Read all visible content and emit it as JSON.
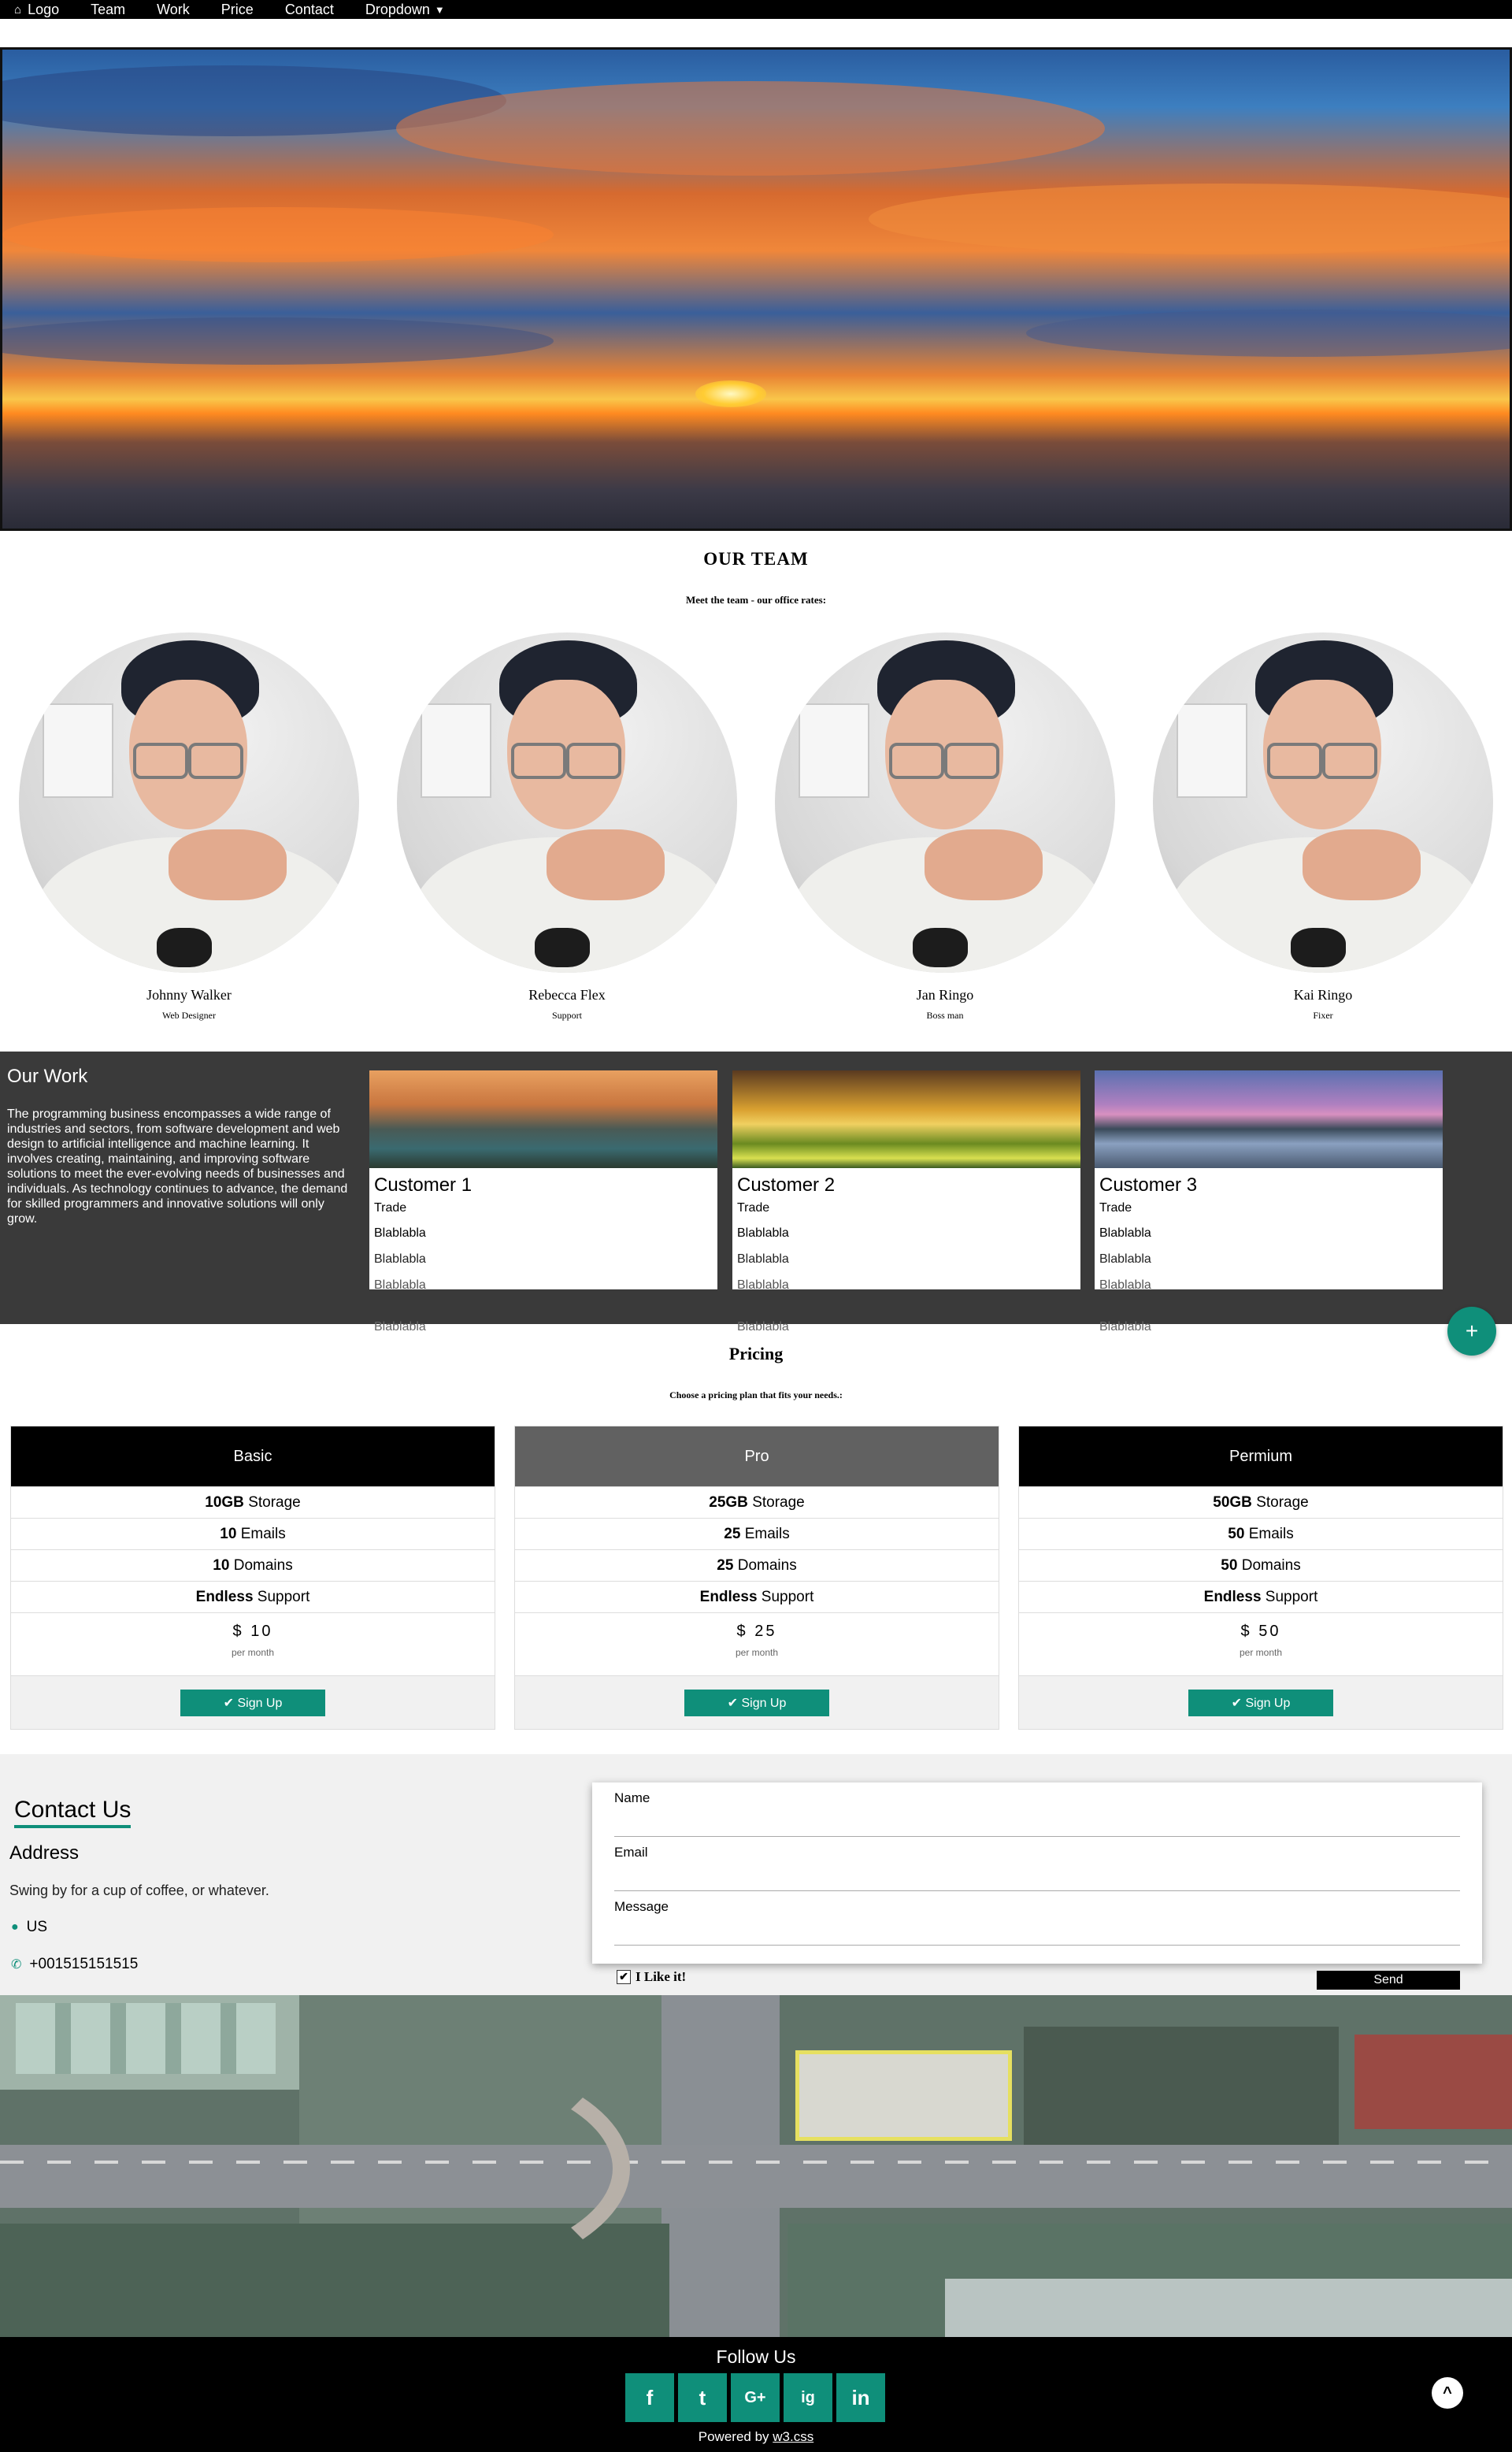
{
  "nav": {
    "logo": "Logo",
    "items": [
      "Team",
      "Work",
      "Price",
      "Contact"
    ],
    "dropdown": "Dropdown"
  },
  "team": {
    "title": "OUR TEAM",
    "subtitle": "Meet the team - our office rates:",
    "members": [
      {
        "name": "Johnny Walker",
        "role": "Web Designer"
      },
      {
        "name": "Rebecca Flex",
        "role": "Support"
      },
      {
        "name": "Jan Ringo",
        "role": "Boss man"
      },
      {
        "name": "Kai Ringo",
        "role": "Fixer"
      }
    ]
  },
  "work": {
    "title": "Our Work",
    "text": "The programming business encompasses a wide range of industries and sectors, from software development and web design to artificial intelligence and machine learning. It involves creating, maintaining, and improving software solutions to meet the ever-evolving needs of businesses and individuals. As technology continues to advance, the demand for skilled programmers and innovative solutions will only grow.",
    "cards": [
      {
        "title": "Customer 1",
        "tag": "Trade",
        "lines": [
          "Blablabla",
          "Blablabla",
          "Blablabla",
          "Blablabla"
        ]
      },
      {
        "title": "Customer 2",
        "tag": "Trade",
        "lines": [
          "Blablabla",
          "Blablabla",
          "Blablabla",
          "Blablabla"
        ]
      },
      {
        "title": "Customer 3",
        "tag": "Trade",
        "lines": [
          "Blablabla",
          "Blablabla",
          "Blablabla",
          "Blablabla"
        ]
      }
    ],
    "fab": "+"
  },
  "pricing": {
    "title": "Pricing",
    "subtitle": "Choose a pricing plan that fits your needs.:",
    "plans": [
      {
        "name": "Basic",
        "storage_b": "10GB",
        "storage": "Storage",
        "emails_b": "10",
        "emails": "Emails",
        "domains_b": "10",
        "domains": "Domains",
        "support_b": "Endless",
        "support": "Support",
        "amount": "$ 10",
        "per": "per month",
        "button": "✔ Sign Up",
        "header_color": "#000000"
      },
      {
        "name": "Pro",
        "storage_b": "25GB",
        "storage": "Storage",
        "emails_b": "25",
        "emails": "Emails",
        "domains_b": "25",
        "domains": "Domains",
        "support_b": "Endless",
        "support": "Support",
        "amount": "$ 25",
        "per": "per month",
        "button": "✔ Sign Up",
        "header_color": "#616161"
      },
      {
        "name": "Permium",
        "storage_b": "50GB",
        "storage": "Storage",
        "emails_b": "50",
        "emails": "Emails",
        "domains_b": "50",
        "domains": "Domains",
        "support_b": "Endless",
        "support": "Support",
        "amount": "$ 50",
        "per": "per month",
        "button": "✔ Sign Up",
        "header_color": "#000000"
      }
    ]
  },
  "contact": {
    "title": "Contact Us",
    "address_heading": "Address",
    "tagline": "Swing by for a cup of coffee, or whatever.",
    "location": "US",
    "phone": "+001515151515",
    "fields": {
      "name": "Name",
      "email": "Email",
      "message": "Message"
    },
    "checkbox": "I Like it!",
    "send": "Send"
  },
  "footer": {
    "follow": "Follow Us",
    "socials": [
      "f",
      "t",
      "G+",
      "ig",
      "in"
    ],
    "powered_prefix": "Powered by ",
    "powered_link": "w3.css",
    "top": "^"
  },
  "colors": {
    "accent": "#0f8f7a",
    "nav": "#000000",
    "work_bg": "#3a3a3a"
  }
}
